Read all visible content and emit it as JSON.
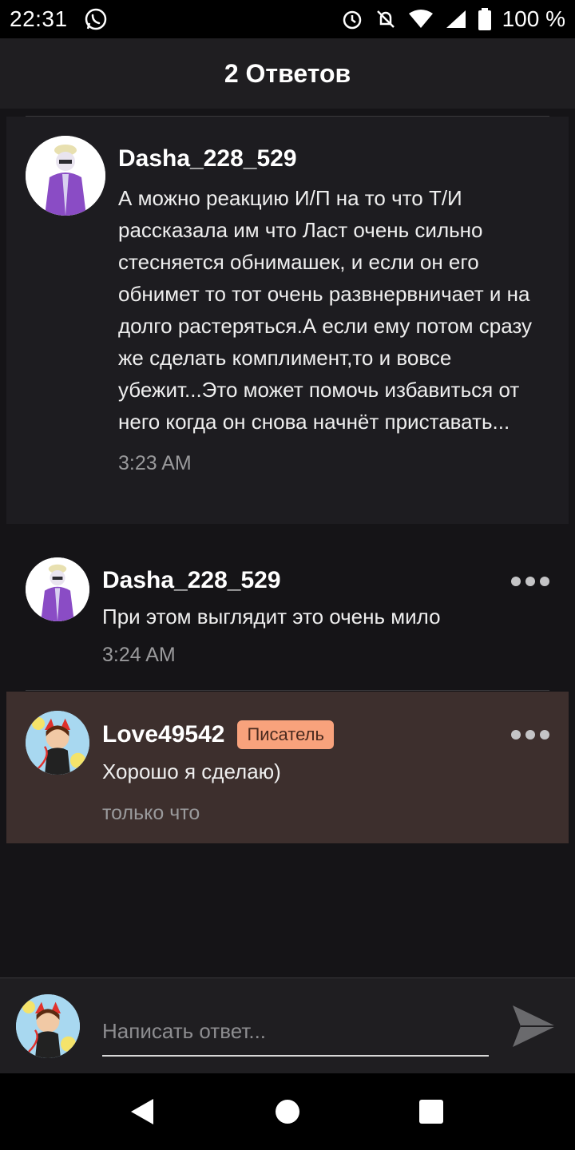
{
  "status_bar": {
    "time": "22:31",
    "battery": "100 %",
    "icons": [
      "whatsapp-icon",
      "alarm-icon",
      "bell-off-icon",
      "wifi-icon",
      "signal-icon",
      "battery-icon"
    ]
  },
  "header": {
    "title": "2 Ответов"
  },
  "comments": [
    {
      "author": "Dasha_228_529",
      "text": "А можно реакцию И/П на то что Т/И рассказала им что Ласт очень сильно стесняется обнимашек, и если он его обнимет то тот очень развнервничает и на долго растеряться.А если ему потом сразу же сделать комплимент,то и вовсе убежит...Это может помочь избавиться от него когда он снова начнёт приставать...",
      "time": "3:23 AM"
    },
    {
      "author": "Dasha_228_529",
      "text": "При этом выглядит это очень мило",
      "time": "3:24 AM"
    },
    {
      "author": "Love49542",
      "badge": "Писатель",
      "text": "Хорошо я сделаю)",
      "time": "только что"
    }
  ],
  "reply": {
    "placeholder": "Написать ответ..."
  },
  "colors": {
    "background": "#151417",
    "header": "#1f1e21",
    "own_comment_bg": "#3d2f2d",
    "badge": "#f8a27c"
  }
}
